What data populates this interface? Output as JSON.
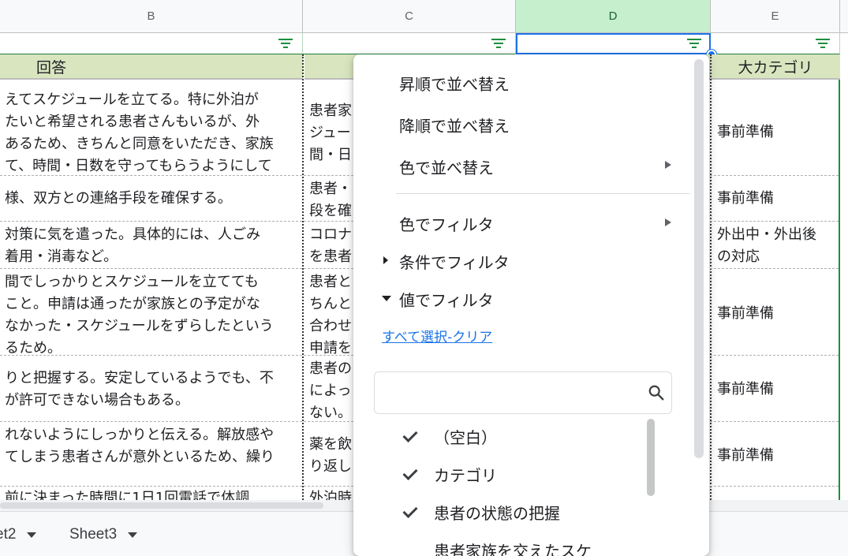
{
  "columns": [
    "B",
    "C",
    "D",
    "E"
  ],
  "header_row": {
    "b": "回答",
    "e": "大カテゴリ"
  },
  "rows": [
    {
      "b": [
        "えてスケジュールを立てる。特に外泊が",
        "たいと希望される患者さんもいるが、外",
        "あるため、きちんと同意をいただき、家族",
        "て、時間・日数を守ってもらうようにして"
      ],
      "c": [
        "患者家",
        "ジュー",
        "間・日"
      ],
      "e": [
        "事前準備"
      ]
    },
    {
      "b": [
        "様、双方との連絡手段を確保する。"
      ],
      "c": [
        "患者・",
        "段を確"
      ],
      "e": [
        "事前準備"
      ]
    },
    {
      "b": [
        "対策に気を遣った。具体的には、人ごみ",
        "着用・消毒など。"
      ],
      "c": [
        "コロナ",
        "を患者"
      ],
      "e": [
        "外出中・外出後",
        "の対応"
      ]
    },
    {
      "b": [
        "間でしっかりとスケジュールを立てても",
        "こと。申請は通ったが家族との予定がな",
        "なかった・スケジュールをずらしたという",
        "るため。"
      ],
      "c": [
        "患者と",
        "ちんと",
        "合わせ",
        "申請を"
      ],
      "e": [
        "事前準備"
      ]
    },
    {
      "b": [
        "りと把握する。安定しているようでも、不",
        "が許可できない場合もある。"
      ],
      "c": [
        "患者の",
        "によっ",
        "ない。"
      ],
      "e": [
        "事前準備"
      ]
    },
    {
      "b": [
        "れないようにしっかりと伝える。解放感や",
        "てしまう患者さんが意外といるため、繰り"
      ],
      "c": [
        "薬を飲",
        "り返し"
      ],
      "e": [
        "事前準備"
      ]
    },
    {
      "b": [
        "前に決まった時間に1日1回電話で体調"
      ],
      "c": [
        "外泊時"
      ],
      "e": [
        ""
      ]
    }
  ],
  "filter_menu": {
    "sort_asc": "昇順で並べ替え",
    "sort_desc": "降順で並べ替え",
    "sort_color": "色で並べ替え",
    "filter_color": "色でフィルタ",
    "filter_condition": "条件でフィルタ",
    "filter_values": "値でフィルタ",
    "select_all": "すべて選択",
    "link_sep": "-",
    "clear": "クリア",
    "search_placeholder": "",
    "values": [
      "（空白）",
      "カテゴリ",
      "患者の状態の把握",
      "患者家族を交えたスケ"
    ]
  },
  "tabs": [
    "et2",
    "Sheet3"
  ]
}
